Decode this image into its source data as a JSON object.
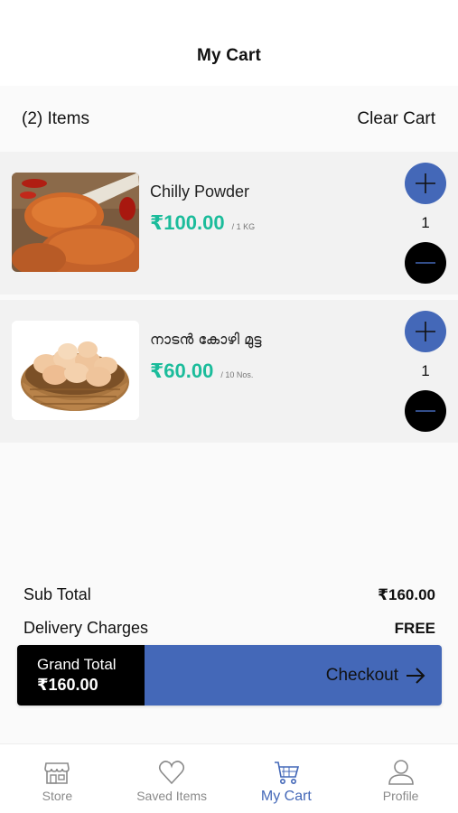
{
  "header": {
    "title": "My Cart"
  },
  "summary": {
    "items_count": "(2) Items",
    "clear_label": "Clear Cart"
  },
  "items": [
    {
      "name": "Chilly Powder",
      "price": "₹100.00",
      "unit": "/ 1 KG",
      "quantity": "1",
      "image_icon": "chilly-powder-image"
    },
    {
      "name": "നാടൻ കോഴി മുട്ട",
      "price": "₹60.00",
      "unit": "/ 10 Nos.",
      "quantity": "1",
      "image_icon": "eggs-basket-image"
    }
  ],
  "totals": {
    "subtotal_label": "Sub Total",
    "subtotal_value": "₹160.00",
    "delivery_label": "Delivery Charges",
    "delivery_value": "FREE"
  },
  "checkout": {
    "grand_total_label": "Grand Total",
    "grand_total_value": "₹160.00",
    "checkout_label": "Checkout"
  },
  "nav": [
    {
      "label": "Store",
      "icon": "store-icon"
    },
    {
      "label": "Saved Items",
      "icon": "heart-icon"
    },
    {
      "label": "My Cart",
      "icon": "cart-icon",
      "active": true
    },
    {
      "label": "Profile",
      "icon": "user-icon"
    }
  ],
  "colors": {
    "accent": "#4468b8",
    "price": "#1bbc9b",
    "dark": "#000000"
  }
}
